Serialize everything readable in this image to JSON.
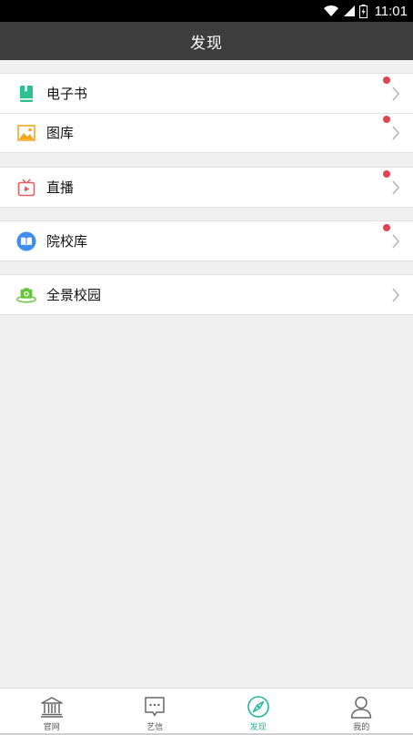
{
  "status_bar": {
    "time": "11:01"
  },
  "header": {
    "title": "发现"
  },
  "groups": [
    {
      "items": [
        {
          "label": "电子书",
          "icon": "ebook-icon",
          "badge": true
        },
        {
          "label": "图库",
          "icon": "gallery-icon",
          "badge": true
        }
      ]
    },
    {
      "items": [
        {
          "label": "直播",
          "icon": "live-tv-icon",
          "badge": true
        }
      ]
    },
    {
      "items": [
        {
          "label": "院校库",
          "icon": "college-book-icon",
          "badge": true
        }
      ]
    },
    {
      "items": [
        {
          "label": "全景校园",
          "icon": "panorama-camera-icon",
          "badge": false
        }
      ]
    }
  ],
  "tabbar": {
    "tabs": [
      {
        "label": "官网",
        "icon": "bank-icon",
        "active": false
      },
      {
        "label": "艺信",
        "icon": "message-icon",
        "active": false
      },
      {
        "label": "发现",
        "icon": "compass-icon",
        "active": true
      },
      {
        "label": "我的",
        "icon": "person-icon",
        "active": false
      }
    ]
  },
  "colors": {
    "header_bg": "#3d3d3d",
    "badge": "#e0454f",
    "accent": "#1fb89a",
    "ebook": "#2ebf8f",
    "gallery": "#f5a623",
    "live": "#ef5b5b",
    "college": "#3e8ef2",
    "panorama": "#66c53a"
  }
}
